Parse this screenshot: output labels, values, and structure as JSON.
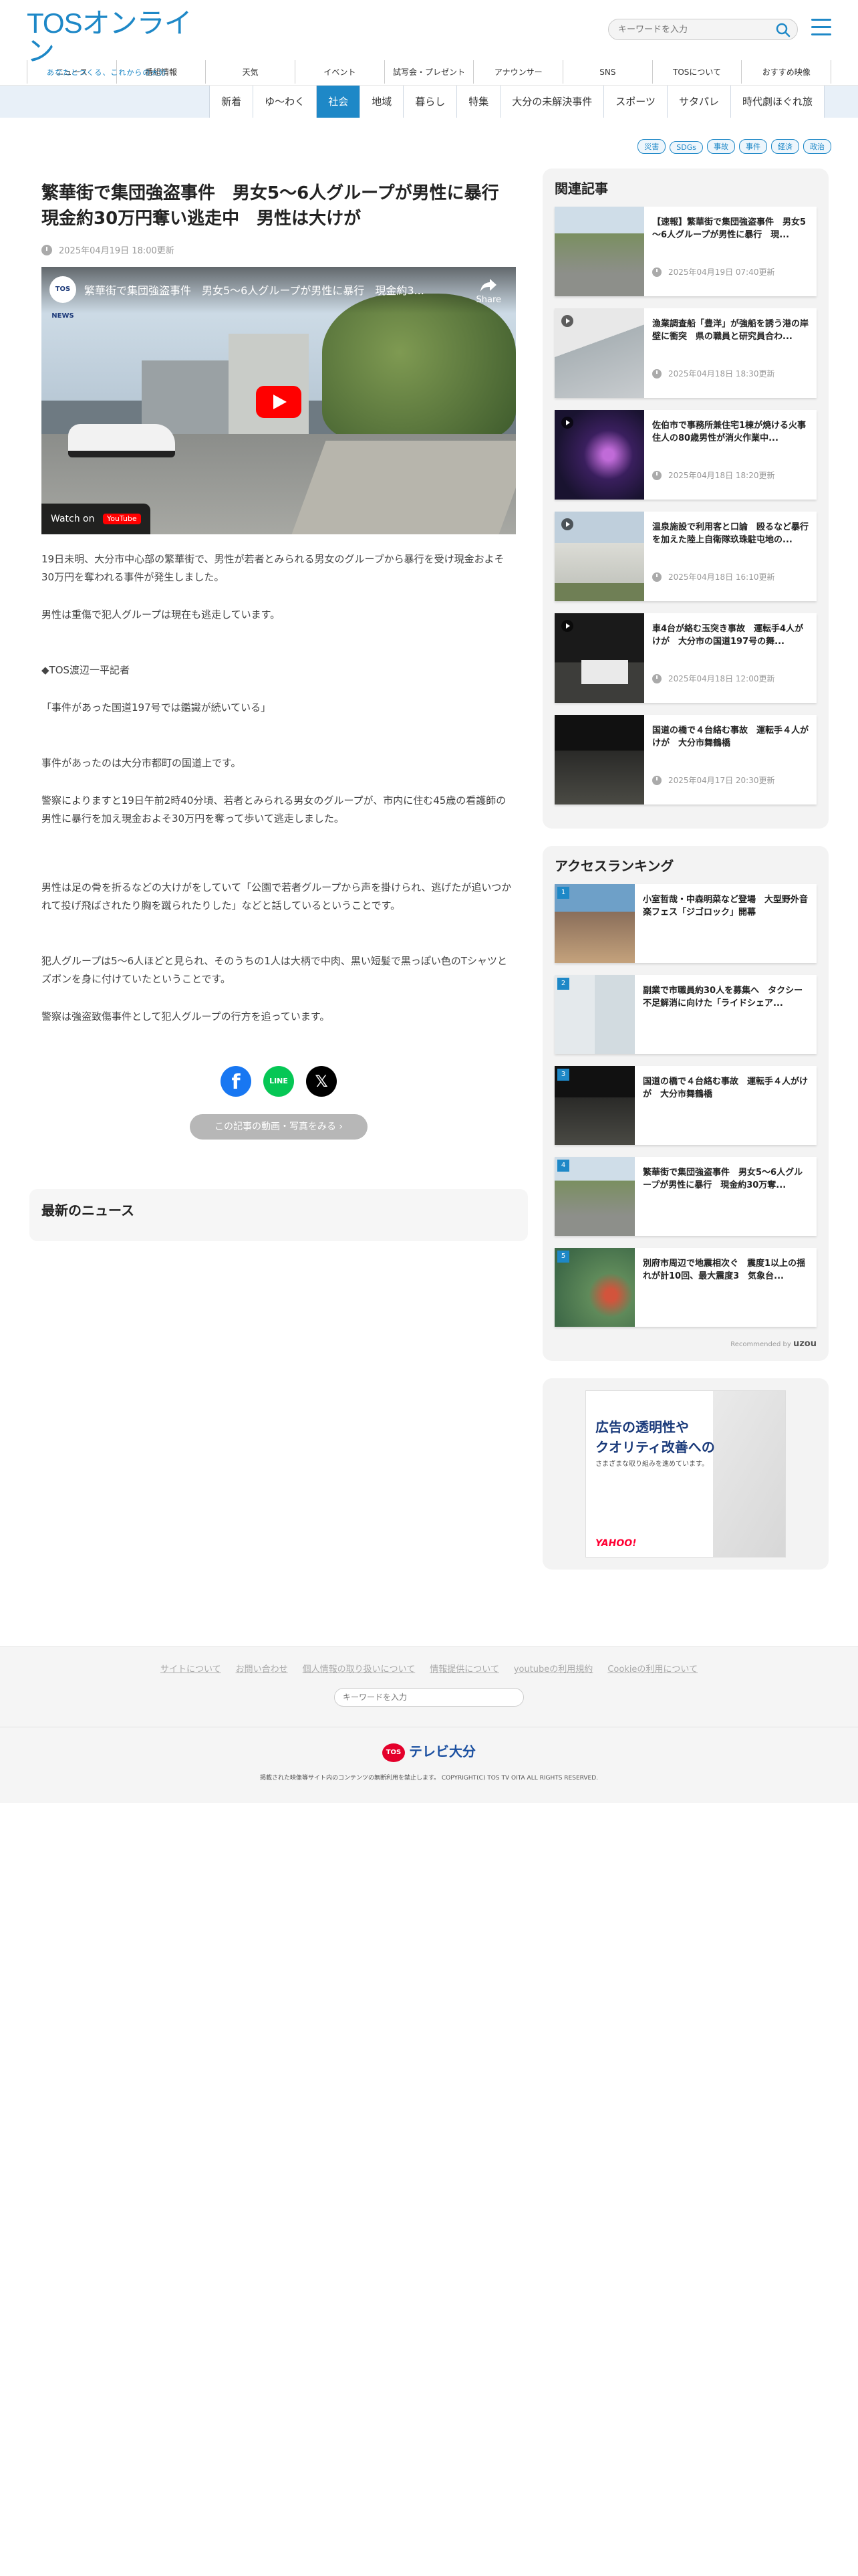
{
  "header": {
    "logo": "TOSオンライン",
    "tagline": "あなたとつくる、これからの大分",
    "search_placeholder": "キーワードを入力"
  },
  "global_nav": [
    "ニュース",
    "番組情報",
    "天気",
    "イベント",
    "試写会・プレゼント",
    "アナウンサー",
    "SNS",
    "TOSについて",
    "おすすめ映像"
  ],
  "category_nav": {
    "items": [
      "新着",
      "ゆ〜わく",
      "社会",
      "地域",
      "暮らし",
      "特集",
      "大分の未解決事件",
      "スポーツ",
      "サタパレ",
      "時代劇ほぐれ旅"
    ],
    "active": "社会"
  },
  "tags": [
    "災害",
    "SDGs",
    "事故",
    "事件",
    "経済",
    "政治"
  ],
  "article": {
    "title": "繁華街で集団強盗事件　男女5～6人グループが男性に暴行　現金約30万円奪い逃走中　男性は大けが",
    "date": "2025年04月19日 18:00更新",
    "video": {
      "channel": "TOS NEWS",
      "title": "繁華街で集団強盗事件　男女5～6人グループが男性に暴行　現金約3...",
      "share": "Share",
      "watch_on": "Watch on",
      "youtube": "YouTube"
    },
    "paragraphs": [
      "19日未明、大分市中心部の繁華街で、男性が若者とみられる男女のグループから暴行を受け現金およそ30万円を奪われる事件が発生しました。",
      "男性は重傷で犯人グループは現在も逃走しています。",
      "◆TOS渡辺一平記者",
      "「事件があった国道197号では鑑識が続いている」",
      "事件があったのは大分市都町の国道上です。",
      "警察によりますと19日午前2時40分頃、若者とみられる男女のグループが、市内に住む45歳の看護師の男性に暴行を加え現金およそ30万円を奪って歩いて逃走しました。",
      "男性は足の骨を折るなどの大けがをしていて「公園で若者グループから声を掛けられ、逃げたが追いつかれて投げ飛ばされたり胸を蹴られたりした」などと話しているということです。",
      "犯人グループは5～6人ほどと見られ、そのうちの1人は大柄で中肉、黒い短髪で黒っぽい色のTシャツとズボンを身に付けていたということです。",
      "警察は強盗致傷事件として犯人グループの行方を追っています。"
    ],
    "more_button": "この記事の動画・写真をみる"
  },
  "social": {
    "facebook": "f",
    "line": "LINE",
    "x": "𝕏"
  },
  "latest": {
    "heading": "最新のニュース"
  },
  "related": {
    "heading": "関連記事",
    "items": [
      {
        "title": "【速報】繁華街で集団強盗事件　男女5～6人グループが男性に暴行　現...",
        "date": "2025年04月19日 07:40更新",
        "video": false
      },
      {
        "title": "漁業調査船「豊洋」が強船を誘う港の岸壁に衝突　県の職員と研究員合わ...",
        "date": "2025年04月18日 18:30更新",
        "video": true
      },
      {
        "title": "佐伯市で事務所兼住宅1棟が焼ける火事　住人の80歳男性が消火作業中...",
        "date": "2025年04月18日 18:20更新",
        "video": true
      },
      {
        "title": "温泉施設で利用客と口論　殴るなど暴行を加えた陸上自衛隊玖珠駐屯地の...",
        "date": "2025年04月18日 16:10更新",
        "video": true
      },
      {
        "title": "車4台が絡む玉突き事故　運転手4人がけが　大分市の国道197号の舞...",
        "date": "2025年04月18日 12:00更新",
        "video": true
      },
      {
        "title": "国道の橋で４台絡む事故　運転手４人がけが　大分市舞鶴橋",
        "date": "2025年04月17日 20:30更新",
        "video": false
      }
    ]
  },
  "ranking": {
    "heading": "アクセスランキング",
    "items": [
      {
        "rank": "1",
        "title": "小室哲哉・中森明菜など登場　大型野外音楽フェス「ジゴロック」開幕"
      },
      {
        "rank": "2",
        "title": "副業で市職員約30人を募集へ　タクシー不足解消に向けた「ライドシェア..."
      },
      {
        "rank": "3",
        "title": "国道の橋で４台絡む事故　運転手４人がけが　大分市舞鶴橋"
      },
      {
        "rank": "4",
        "title": "繁華街で集団強盗事件　男女5～6人グループが男性に暴行　現金約30万奪..."
      },
      {
        "rank": "5",
        "title": "別府市周辺で地震相次ぐ　震度1以上の揺れが計10回、最大震度3　気象台..."
      }
    ],
    "recommended_by": "Recommended by",
    "recommender": "uzou"
  },
  "ad": {
    "line1": "広告の透明性や",
    "line2": "クオリティ改善への",
    "line3": "さまざまな取り組みを進めています。",
    "brand": "YAHOO!"
  },
  "footer": {
    "links": [
      "サイトについて",
      "お問い合わせ",
      "個人情報の取り扱いについて",
      "情報提供について",
      "youtubeの利用規約",
      "Cookieの利用について"
    ],
    "search_placeholder": "キーワードを入力",
    "logo": "テレビ大分",
    "logo_mark": "TOS",
    "copyright": "掲載された映像等サイト内のコンテンツの無断利用を禁止します。 COPYRIGHT(C) TOS TV OITA ALL RIGHTS RESERVED."
  },
  "colors": {
    "brand": "#1e88c7",
    "active_tab": "#1e88c7",
    "rank_badge": "#1e88c7"
  }
}
